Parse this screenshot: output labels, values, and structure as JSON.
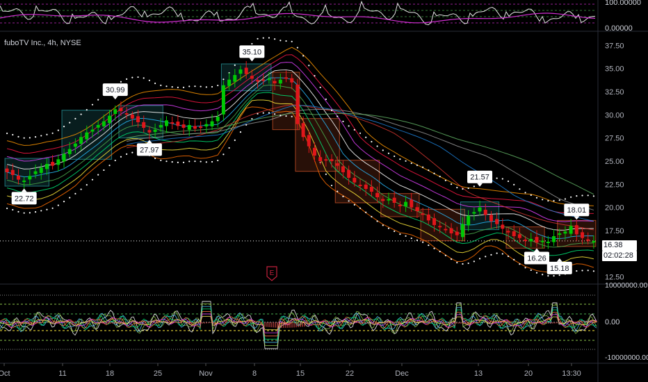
{
  "header": {
    "symbol_title": "fuboTV Inc., 4h, NYSE"
  },
  "rsi_pane": {
    "ticks": [
      "100.00000",
      "0.00000"
    ]
  },
  "oscillator_pane": {
    "ticks": [
      "10000000.00",
      "0.00",
      "-10000000.00"
    ]
  },
  "last_price": {
    "value": "16.38",
    "countdown": "02:02:28"
  },
  "marker": {
    "label": "E"
  },
  "colors": {
    "up": "#00c805",
    "down": "#e0161b",
    "box_up": "#2aa3a8",
    "box_down": "#e05a2b",
    "dots": "#ffffff",
    "rsi": "#d42fd4"
  },
  "chart_data": {
    "type": "candlestick",
    "title": "fuboTV Inc., 4h, NYSE",
    "y_ticks": [
      37.5,
      35.0,
      32.5,
      30.0,
      27.5,
      25.0,
      22.5,
      20.0,
      17.5,
      15.0,
      12.5
    ],
    "ylim": [
      11.8,
      38.8
    ],
    "x_ticks": [
      "Oct",
      "11",
      "18",
      "25",
      "Nov",
      "8",
      "15",
      "22",
      "Dec",
      "13",
      "20",
      "13:30"
    ],
    "callouts": [
      {
        "label": "22.72",
        "value": 22.72,
        "position": "below"
      },
      {
        "label": "30.99",
        "value": 30.99,
        "position": "above"
      },
      {
        "label": "27.97",
        "value": 27.97,
        "position": "below"
      },
      {
        "label": "35.10",
        "value": 35.1,
        "position": "above"
      },
      {
        "label": "16.26",
        "value": 16.26,
        "position": "below"
      },
      {
        "label": "21.57",
        "value": 21.57,
        "position": "above"
      },
      {
        "label": "15.18",
        "value": 15.18,
        "position": "below"
      },
      {
        "label": "18.01",
        "value": 18.01,
        "position": "above"
      }
    ],
    "close_series": [
      23.8,
      23.5,
      23.0,
      22.9,
      23.4,
      23.9,
      24.3,
      24.7,
      24.5,
      25.2,
      25.8,
      26.3,
      26.9,
      27.6,
      28.1,
      28.4,
      28.9,
      29.3,
      29.9,
      30.6,
      30.4,
      30.1,
      29.6,
      29.2,
      28.6,
      28.1,
      28.4,
      28.9,
      29.4,
      29.1,
      28.8,
      28.6,
      28.9,
      28.5,
      28.7,
      29.0,
      29.3,
      29.8,
      33.2,
      33.8,
      34.3,
      34.9,
      34.4,
      33.9,
      33.6,
      33.8,
      33.9,
      33.4,
      33.8,
      34.0,
      33.5,
      29.0,
      27.6,
      26.6,
      25.6,
      25.0,
      25.1,
      25.0,
      24.5,
      23.8,
      23.2,
      22.7,
      22.4,
      22.0,
      21.7,
      21.1,
      20.7,
      20.9,
      20.5,
      20.2,
      20.6,
      20.0,
      19.6,
      19.2,
      18.6,
      18.1,
      17.9,
      17.6,
      17.2,
      17.0,
      18.2,
      19.1,
      19.5,
      20.0,
      19.2,
      18.5,
      18.2,
      17.7,
      17.3,
      16.9,
      16.7,
      16.5,
      16.6,
      16.2,
      16.4,
      16.3,
      16.9,
      17.2,
      17.4,
      18.0,
      17.1,
      16.7,
      16.4,
      16.38
    ],
    "volume_oscillator_range": [
      -10000000,
      10000000
    ]
  }
}
